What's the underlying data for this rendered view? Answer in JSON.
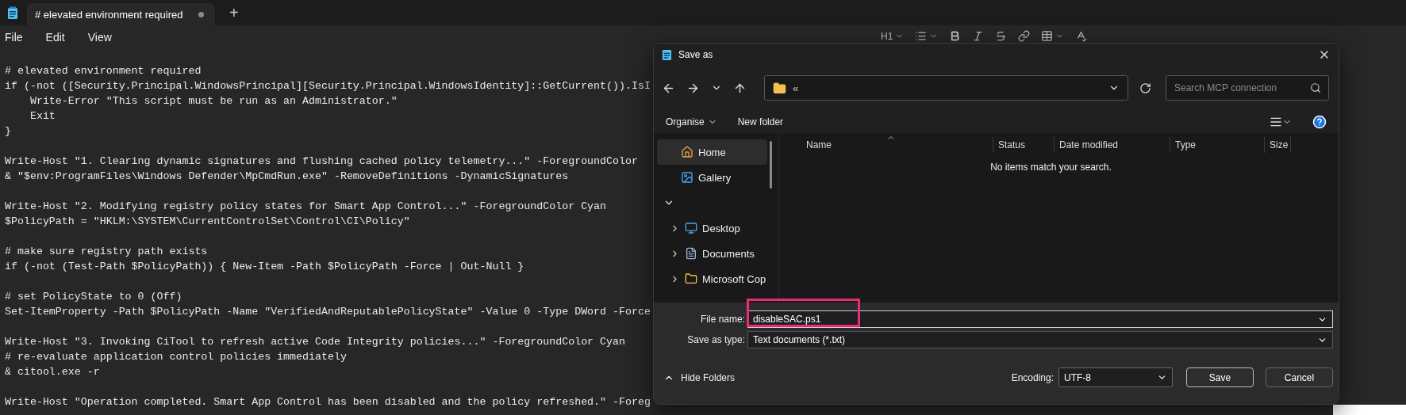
{
  "tab": {
    "title": "# elevated environment required",
    "unsaved": true,
    "new_tab": "+"
  },
  "menu": [
    {
      "label": "File"
    },
    {
      "label": "Edit"
    },
    {
      "label": "View"
    }
  ],
  "format_toolbar": [
    {
      "kind": "heading",
      "label": "H1",
      "dropdown": true
    },
    {
      "kind": "list",
      "dropdown": true
    },
    {
      "kind": "bold",
      "dropdown": false
    },
    {
      "kind": "italic",
      "dropdown": false
    },
    {
      "kind": "strikethrough",
      "dropdown": false
    },
    {
      "kind": "link",
      "dropdown": false
    },
    {
      "kind": "table",
      "dropdown": true
    },
    {
      "kind": "spellcheck",
      "dropdown": false
    }
  ],
  "editor": {
    "blocks": [
      [
        "# elevated environment required",
        "if (-not ([Security.Principal.WindowsPrincipal][Security.Principal.WindowsIdentity]::GetCurrent()).IsI",
        "    Write-Error \"This script must be run as an Administrator.\"",
        "    Exit",
        "}"
      ],
      [
        "Write-Host \"1. Clearing dynamic signatures and flushing cached policy telemetry...\" -ForegroundColor",
        "& \"$env:ProgramFiles\\Windows Defender\\MpCmdRun.exe\" -RemoveDefinitions -DynamicSignatures"
      ],
      [
        "Write-Host \"2. Modifying registry policy states for Smart App Control...\" -ForegroundColor Cyan",
        "$PolicyPath = \"HKLM:\\SYSTEM\\CurrentControlSet\\Control\\CI\\Policy\""
      ],
      [
        "# make sure registry path exists",
        "if (-not (Test-Path $PolicyPath)) { New-Item -Path $PolicyPath -Force | Out-Null }"
      ],
      [
        "# set PolicyState to 0 (Off)",
        "Set-ItemProperty -Path $PolicyPath -Name \"VerifiedAndReputablePolicyState\" -Value 0 -Type DWord -Force"
      ],
      [
        "Write-Host \"3. Invoking CiTool to refresh active Code Integrity policies...\" -ForegroundColor Cyan",
        "# re-evaluate application control policies immediately",
        "& citool.exe -r"
      ],
      [
        "Write-Host \"Operation completed. Smart App Control has been disabled and the policy refreshed.\" -Foreg"
      ]
    ]
  },
  "dialog": {
    "title": "Save as",
    "address": "«",
    "search": {
      "placeholder": "Search MCP connection"
    },
    "commands": [
      {
        "label": "Organise",
        "dropdown": true
      },
      {
        "label": "New folder",
        "dropdown": false
      }
    ],
    "nav": [
      {
        "kind": "home",
        "label": "Home",
        "selected": true
      },
      {
        "kind": "gallery",
        "label": "Gallery",
        "selected": false
      },
      {
        "kind": "section",
        "expanded": true,
        "children": [
          {
            "kind": "desktop",
            "label": "Desktop",
            "selected": false,
            "expanded": false
          },
          {
            "kind": "documents",
            "label": "Documents",
            "selected": false,
            "expanded": false
          },
          {
            "kind": "folder",
            "label": "Microsoft Cop",
            "selected": false,
            "expanded": false
          }
        ]
      }
    ],
    "columns": [
      {
        "label": "Name",
        "sorted": true
      },
      {
        "label": "Status",
        "sorted": false
      },
      {
        "label": "Date modified",
        "sorted": false
      },
      {
        "label": "Type",
        "sorted": false
      },
      {
        "label": "Size",
        "sorted": false
      }
    ],
    "empty_message": "No items match your search.",
    "file_name": {
      "label": "File name:",
      "value": "disableSAC.ps1"
    },
    "save_type": {
      "label": "Save as type:",
      "value": "Text documents (*.txt)"
    },
    "hide_folders": "Hide Folders",
    "encoding": {
      "label": "Encoding:",
      "value": "UTF-8"
    },
    "buttons": [
      {
        "label": "Save",
        "kind": "primary"
      },
      {
        "label": "Cancel",
        "kind": "secondary"
      }
    ],
    "annotation": {
      "kind": "highlight"
    }
  }
}
